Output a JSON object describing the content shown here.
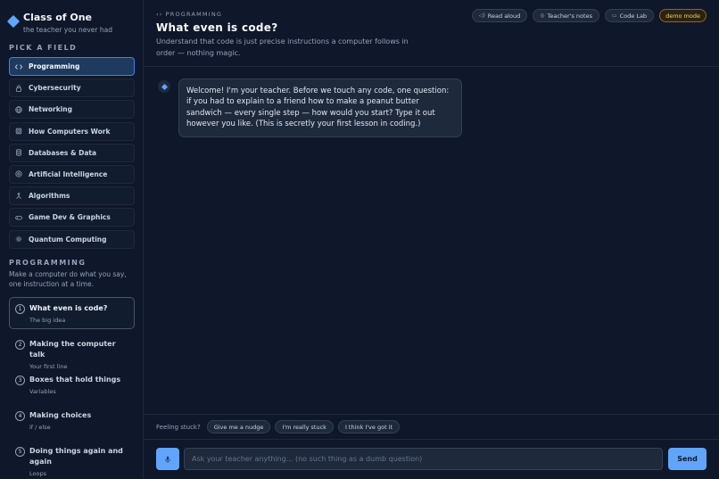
{
  "brand": {
    "title": "Class of One",
    "subtitle": "the teacher you never had"
  },
  "sidebar": {
    "pick_label": "PICK A FIELD",
    "fields": [
      {
        "label": "Programming",
        "icon": "code-icon",
        "active": true
      },
      {
        "label": "Cybersecurity",
        "icon": "lock-icon",
        "active": false
      },
      {
        "label": "Networking",
        "icon": "globe-icon",
        "active": false
      },
      {
        "label": "How Computers Work",
        "icon": "chip-icon",
        "active": false
      },
      {
        "label": "Databases & Data",
        "icon": "database-icon",
        "active": false
      },
      {
        "label": "Artificial Intelligence",
        "icon": "brain-icon",
        "active": false
      },
      {
        "label": "Algorithms",
        "icon": "branch-icon",
        "active": false
      },
      {
        "label": "Game Dev & Graphics",
        "icon": "gamepad-icon",
        "active": false
      },
      {
        "label": "Quantum Computing",
        "icon": "atom-icon",
        "active": false
      }
    ],
    "track_label": "PROGRAMMING",
    "track_description": "Make a computer do what you say, one instruction at a time.",
    "lessons": [
      {
        "num": "1",
        "title": "What even is code?",
        "subtitle": "The big idea",
        "active": true
      },
      {
        "num": "2",
        "title": "Making the computer talk",
        "subtitle": "Your first line",
        "active": false
      },
      {
        "num": "3",
        "title": "Boxes that hold things",
        "subtitle": "Variables",
        "active": false
      },
      {
        "num": "4",
        "title": "Making choices",
        "subtitle": "if / else",
        "active": false
      },
      {
        "num": "5",
        "title": "Doing things again and again",
        "subtitle": "Loops",
        "active": false
      }
    ]
  },
  "header": {
    "breadcrumb": "PROGRAMMING",
    "title": "What even is code?",
    "subtitle": "Understand that code is just precise instructions a computer follows in order — nothing magic.",
    "buttons": {
      "read_aloud": "Read aloud",
      "teacher_notes": "Teacher's notes",
      "code_lab": "Code Lab"
    },
    "demo_badge": "demo mode"
  },
  "chat": {
    "messages": [
      {
        "role": "teacher",
        "text": "Welcome! I'm your teacher. Before we touch any code, one question: if you had to explain to a friend how to make a peanut butter sandwich — every single step — how would you start? Type it out however you like. (This is secretly your first lesson in coding.)"
      }
    ]
  },
  "stuck": {
    "label": "Feeling stuck?",
    "chips": [
      "Give me a nudge",
      "I'm really stuck",
      "I think I've got it"
    ]
  },
  "composer": {
    "placeholder": "Ask your teacher anything... (no such thing as a dumb question)",
    "send_label": "Send"
  },
  "colors": {
    "accent": "#60a5fa",
    "background": "#0f172a",
    "panel": "#1e293b",
    "demo": "#fcd34d"
  }
}
